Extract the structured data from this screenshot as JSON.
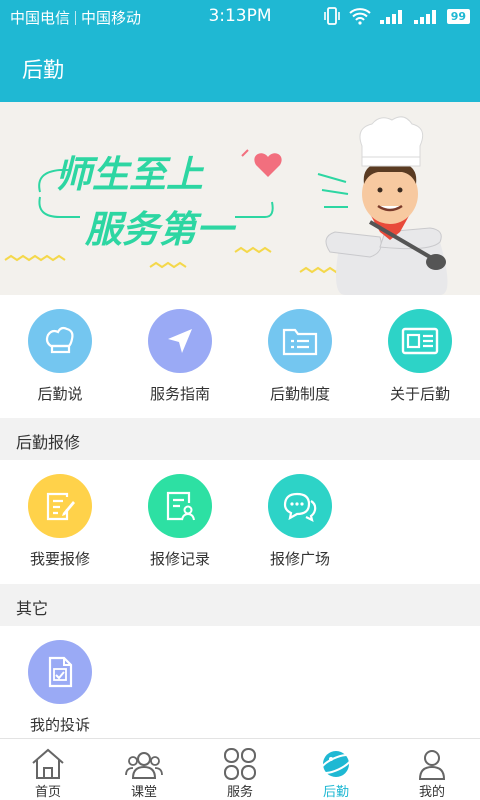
{
  "status_bar": {
    "carrier1": "中国电信",
    "carrier2": "中国移动",
    "time": "3:13PM",
    "battery": "99"
  },
  "header": {
    "title": "后勤"
  },
  "banner": {
    "slogan_line1": "师生至上",
    "slogan_line2": "服务第一"
  },
  "quick_menu": [
    {
      "label": "后勤说",
      "icon": "chef-hat-icon",
      "color": "#74c6f0"
    },
    {
      "label": "服务指南",
      "icon": "navigation-arrow-icon",
      "color": "#9aaaf5"
    },
    {
      "label": "后勤制度",
      "icon": "folder-list-icon",
      "color": "#74c6f0"
    },
    {
      "label": "关于后勤",
      "icon": "newspaper-icon",
      "color": "#2dd3c7"
    }
  ],
  "repair_section": {
    "title": "后勤报修",
    "items": [
      {
        "label": "我要报修",
        "icon": "edit-document-icon",
        "color": "#ffd24a"
      },
      {
        "label": "报修记录",
        "icon": "record-user-icon",
        "color": "#2de0a3"
      },
      {
        "label": "报修广场",
        "icon": "chat-bubbles-icon",
        "color": "#2dd3c7"
      }
    ]
  },
  "other_section": {
    "title": "其它",
    "items": [
      {
        "label": "我的投诉",
        "icon": "complaint-document-icon",
        "color": "#9aaaf5"
      }
    ]
  },
  "tabs": [
    {
      "label": "首页",
      "icon": "home-icon",
      "active": false
    },
    {
      "label": "课堂",
      "icon": "users-icon",
      "active": false
    },
    {
      "label": "服务",
      "icon": "grid-icon",
      "active": false
    },
    {
      "label": "后勤",
      "icon": "planet-icon",
      "active": true
    },
    {
      "label": "我的",
      "icon": "person-icon",
      "active": false
    }
  ],
  "colors": {
    "accent": "#1fb8d3",
    "section_bg": "#f2f2f2"
  }
}
